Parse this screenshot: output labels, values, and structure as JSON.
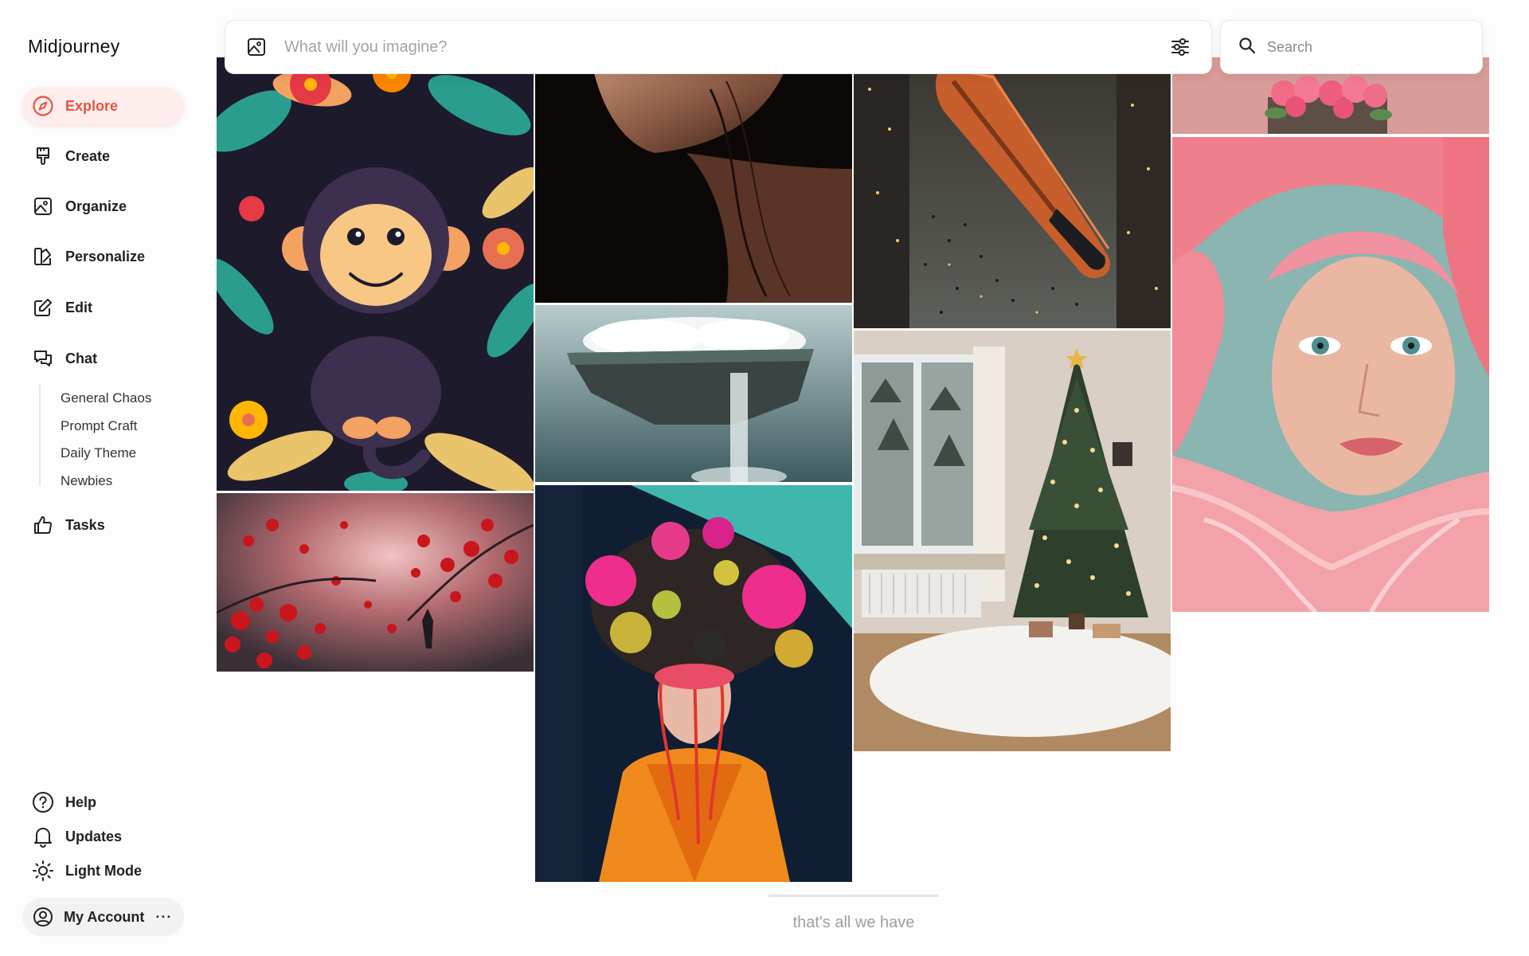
{
  "app": {
    "title": "Midjourney"
  },
  "sidebar": {
    "nav": [
      {
        "label": "Explore",
        "icon": "compass-icon",
        "active": true
      },
      {
        "label": "Create",
        "icon": "brush-icon",
        "active": false
      },
      {
        "label": "Organize",
        "icon": "image-icon",
        "active": false
      },
      {
        "label": "Personalize",
        "icon": "palette-icon",
        "active": false
      },
      {
        "label": "Edit",
        "icon": "edit-icon",
        "active": false
      },
      {
        "label": "Chat",
        "icon": "chat-icon",
        "active": false
      }
    ],
    "chat_rooms": [
      "General Chaos",
      "Prompt Craft",
      "Daily Theme",
      "Newbies"
    ],
    "tasks": {
      "label": "Tasks",
      "icon": "thumbs-up-icon"
    },
    "bottom": [
      {
        "label": "Help",
        "icon": "help-icon"
      },
      {
        "label": "Updates",
        "icon": "bell-icon"
      },
      {
        "label": "Light Mode",
        "icon": "sun-icon"
      }
    ],
    "account": {
      "label": "My Account",
      "more": "···",
      "icon": "user-circle-icon"
    }
  },
  "prompt": {
    "placeholder": "What will you imagine?",
    "value": "",
    "image_icon": "image-icon",
    "settings_icon": "sliders-icon"
  },
  "search": {
    "placeholder": "Search",
    "value": "",
    "icon": "search-icon"
  },
  "gallery": {
    "images": [
      {
        "name": "monkey-illustration-image"
      },
      {
        "name": "red-blossom-forest-image"
      },
      {
        "name": "portrait-chin-closeup-image"
      },
      {
        "name": "floating-island-waterfall-image"
      },
      {
        "name": "colorful-headdress-portrait-image"
      },
      {
        "name": "futuristic-train-city-image"
      },
      {
        "name": "christmas-tree-room-image"
      },
      {
        "name": "pink-roses-image"
      },
      {
        "name": "pink-feather-portrait-image"
      }
    ]
  },
  "footer": {
    "end_text": "that's all we have"
  },
  "colors": {
    "accent": "#e5533f",
    "active_bg": "#fdeeed"
  }
}
